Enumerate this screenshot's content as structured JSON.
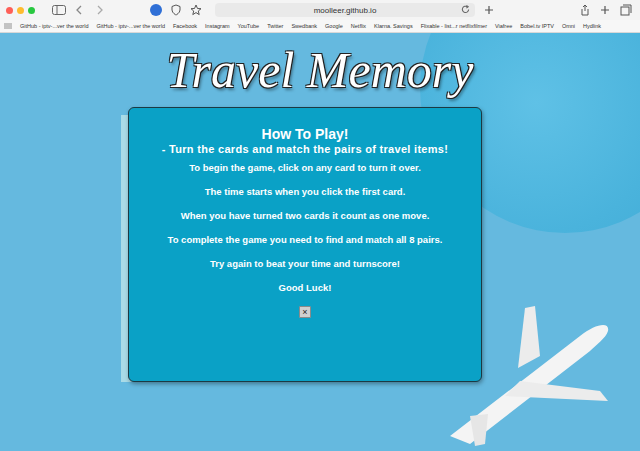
{
  "browser": {
    "url": "moolleer.github.io",
    "bookmarks": [
      "GitHub - iptv-...ver the world",
      "GitHub - iptv-...ver the world",
      "Facebook",
      "Instagram",
      "YouTube",
      "Twitter",
      "Swedbank",
      "Google",
      "Netflix",
      "Klarna. Savings",
      "Flixable - list...r netflixfilmer",
      "Viafree",
      "Bobel.tv IPTV",
      "Omni",
      "Hydlink"
    ]
  },
  "page": {
    "title": "Travel Memory"
  },
  "modal": {
    "heading": "How To Play!",
    "subheading": "- Turn the cards and match the pairs of travel items!",
    "lines": [
      "To begin the game, click on any card to turn it over.",
      "The time starts when you click the first card.",
      "When you have turned two cards it count as one move.",
      "To complete the game you need to find and match all 8 pairs.",
      "Try again to beat your time and turnscore!",
      "Good Luck!"
    ],
    "close": "×"
  }
}
